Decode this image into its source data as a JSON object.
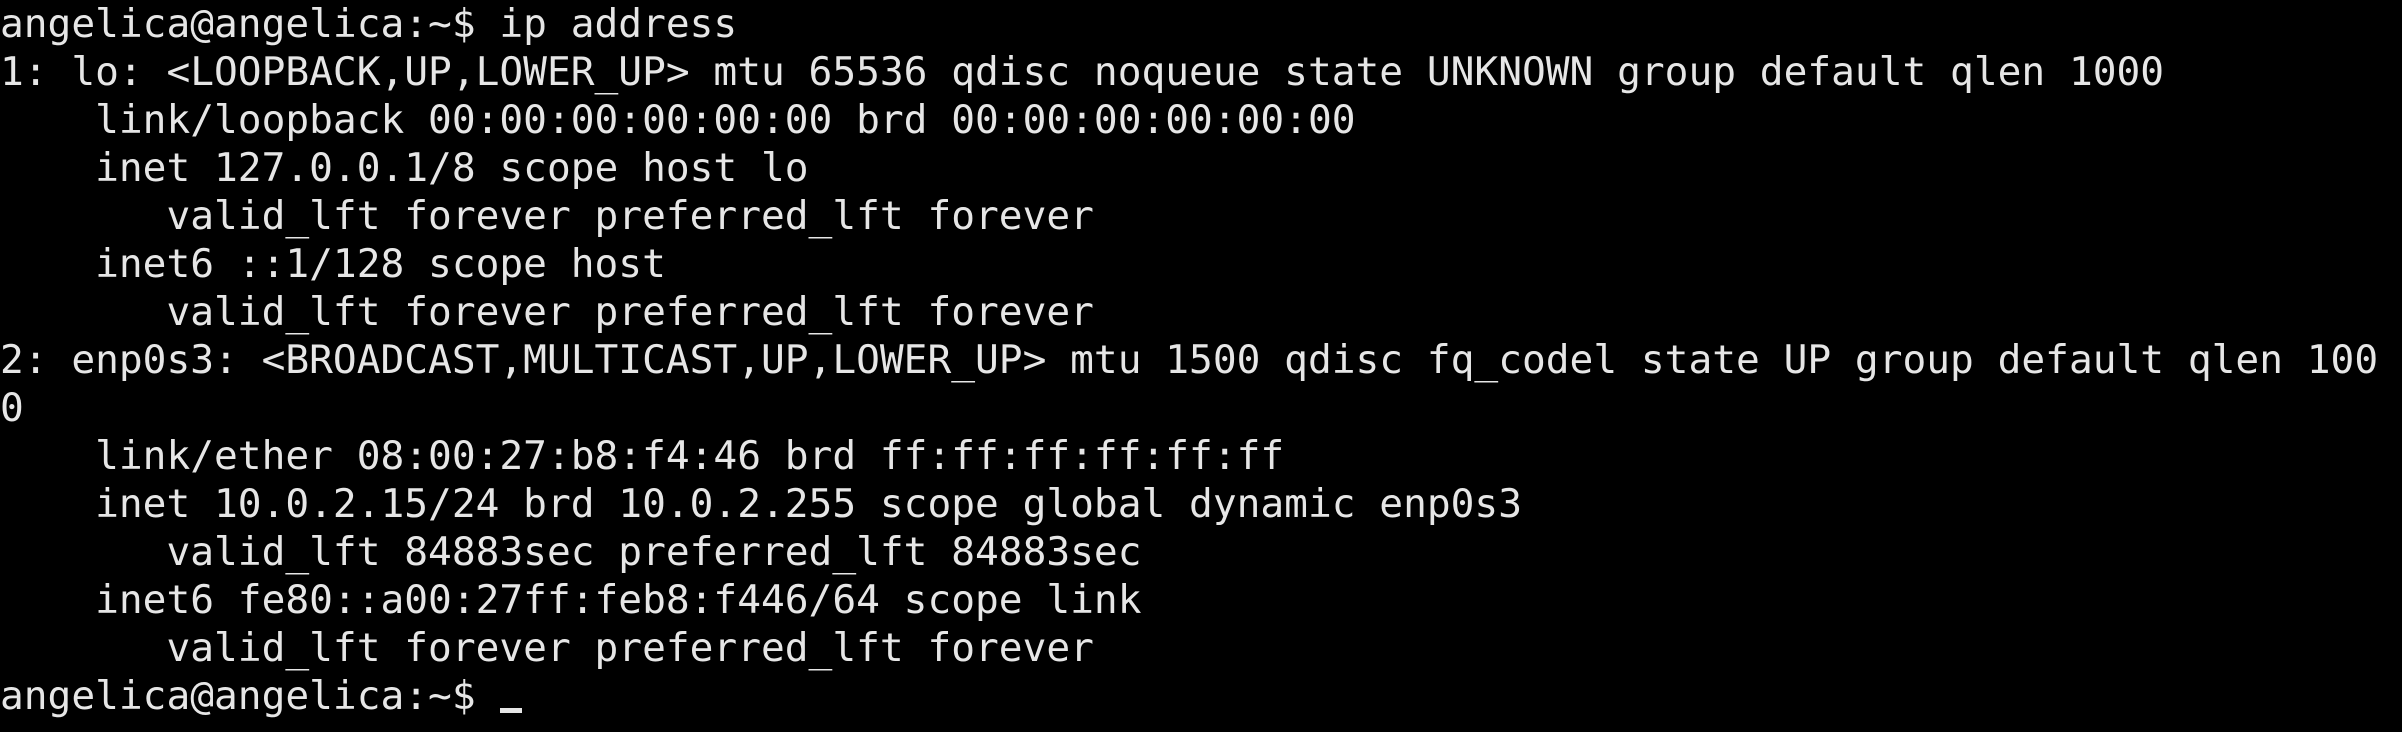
{
  "terminal": {
    "lines": [
      "angelica@angelica:~$ ip address",
      "1: lo: <LOOPBACK,UP,LOWER_UP> mtu 65536 qdisc noqueue state UNKNOWN group default qlen 1000",
      "    link/loopback 00:00:00:00:00:00 brd 00:00:00:00:00:00",
      "    inet 127.0.0.1/8 scope host lo",
      "       valid_lft forever preferred_lft forever",
      "    inet6 ::1/128 scope host",
      "       valid_lft forever preferred_lft forever",
      "2: enp0s3: <BROADCAST,MULTICAST,UP,LOWER_UP> mtu 1500 qdisc fq_codel state UP group default qlen 100",
      "0",
      "    link/ether 08:00:27:b8:f4:46 brd ff:ff:ff:ff:ff:ff",
      "    inet 10.0.2.15/24 brd 10.0.2.255 scope global dynamic enp0s3",
      "       valid_lft 84883sec preferred_lft 84883sec",
      "    inet6 fe80::a00:27ff:feb8:f446/64 scope link",
      "       valid_lft forever preferred_lft forever"
    ],
    "prompt": "angelica@angelica:~$ "
  },
  "colors": {
    "background": "#000000",
    "foreground": "#e6e6e6"
  }
}
